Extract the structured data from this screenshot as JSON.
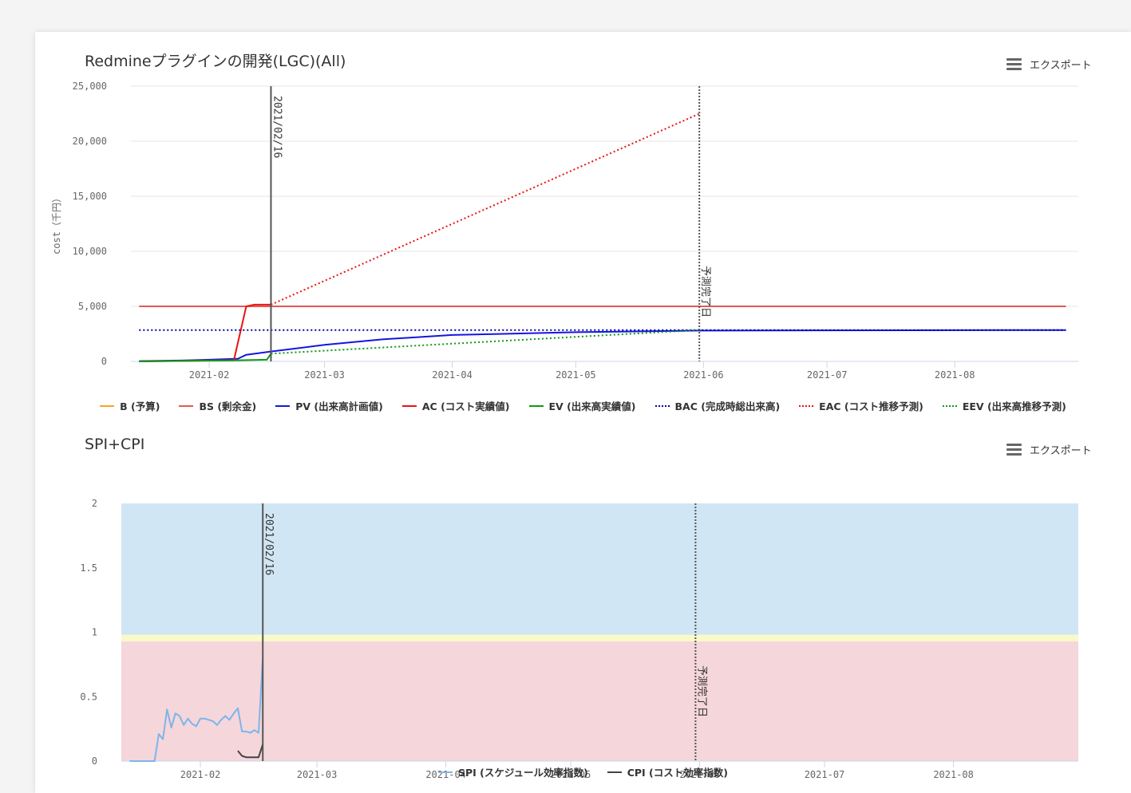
{
  "export_label": "エクスポート",
  "chart_data": [
    {
      "type": "line",
      "title": "Redmineプラグインの開発(LGC)(All)",
      "ylabel": "cost（千円）",
      "xlabel": "",
      "x_range": [
        "2021-01-13",
        "2021-08-31"
      ],
      "ylim": [
        0,
        25000
      ],
      "y_ticks": [
        "0",
        "5,000",
        "10,000",
        "15,000",
        "20,000",
        "25,000"
      ],
      "y_tick_values": [
        0,
        5000,
        10000,
        15000,
        20000,
        25000
      ],
      "x_ticks": [
        "2021-02",
        "2021-03",
        "2021-04",
        "2021-05",
        "2021-06",
        "2021-07",
        "2021-08"
      ],
      "x_tick_dates": [
        "2021-02-01",
        "2021-03-01",
        "2021-04-01",
        "2021-05-01",
        "2021-06-01",
        "2021-07-01",
        "2021-08-01"
      ],
      "grid": true,
      "legend_position": "bottom",
      "plot_lines": [
        {
          "date": "2021-02-16",
          "label": "2021/02/16",
          "style": "solid",
          "color": "#555555"
        },
        {
          "date": "2021-05-31",
          "label": "予測完了日",
          "style": "dotted",
          "color": "#555555"
        }
      ],
      "series": [
        {
          "name": "B (予算)",
          "color": "#f5a623",
          "dash": "solid",
          "points": []
        },
        {
          "name": "BS (剰余金)",
          "color": "#e05a52",
          "dash": "solid",
          "points": [
            [
              "2021-01-15",
              5000
            ],
            [
              "2021-08-28",
              5000
            ]
          ]
        },
        {
          "name": "PV (出来高計画値)",
          "color": "#1515e0",
          "dash": "solid",
          "points": [
            [
              "2021-01-15",
              30
            ],
            [
              "2021-01-25",
              80
            ],
            [
              "2021-02-01",
              150
            ],
            [
              "2021-02-08",
              250
            ],
            [
              "2021-02-10",
              600
            ],
            [
              "2021-02-16",
              900
            ],
            [
              "2021-03-01",
              1500
            ],
            [
              "2021-03-15",
              2000
            ],
            [
              "2021-04-01",
              2400
            ],
            [
              "2021-05-01",
              2650
            ],
            [
              "2021-05-31",
              2800
            ],
            [
              "2021-08-28",
              2850
            ]
          ]
        },
        {
          "name": "AC (コスト実績値)",
          "color": "#ee1111",
          "dash": "solid",
          "points": [
            [
              "2021-01-15",
              0
            ],
            [
              "2021-02-07",
              100
            ],
            [
              "2021-02-10",
              5000
            ],
            [
              "2021-02-12",
              5150
            ],
            [
              "2021-02-16",
              5150
            ]
          ]
        },
        {
          "name": "EV (出来高実績値)",
          "color": "#119911",
          "dash": "solid",
          "points": [
            [
              "2021-01-15",
              0
            ],
            [
              "2021-02-08",
              100
            ],
            [
              "2021-02-15",
              150
            ],
            [
              "2021-02-16",
              700
            ]
          ]
        },
        {
          "name": "BAC (完成時総出来高)",
          "color": "#0000aa",
          "dash": "dotted",
          "points": [
            [
              "2021-01-15",
              2850
            ],
            [
              "2021-08-28",
              2850
            ]
          ]
        },
        {
          "name": "EAC (コスト推移予測)",
          "color": "#ee1111",
          "dash": "dotted",
          "points": [
            [
              "2021-02-16",
              5150
            ],
            [
              "2021-05-31",
              22500
            ]
          ]
        },
        {
          "name": "EEV (出来高推移予測)",
          "color": "#119911",
          "dash": "dotted",
          "points": [
            [
              "2021-02-16",
              700
            ],
            [
              "2021-05-31",
              2850
            ]
          ]
        }
      ]
    },
    {
      "type": "line",
      "title": "SPI+CPI",
      "xlabel": "",
      "ylabel": "",
      "x_range": [
        "2021-01-13",
        "2021-08-31"
      ],
      "ylim": [
        0,
        2
      ],
      "y_ticks": [
        "0",
        "0.5",
        "1",
        "1.5",
        "2"
      ],
      "y_tick_values": [
        0,
        0.5,
        1,
        1.5,
        2
      ],
      "x_ticks": [
        "2021-02",
        "2021-03",
        "2021-04",
        "2021-05",
        "2021-06",
        "2021-07",
        "2021-08"
      ],
      "x_tick_dates": [
        "2021-02-01",
        "2021-03-01",
        "2021-04-01",
        "2021-05-01",
        "2021-06-01",
        "2021-07-01",
        "2021-08-01"
      ],
      "grid": false,
      "legend_position": "bottom",
      "bands": [
        {
          "from": 0,
          "to": 0.93,
          "color": "#f5d6da"
        },
        {
          "from": 0.93,
          "to": 0.98,
          "color": "#fafac8"
        },
        {
          "from": 0.98,
          "to": 2,
          "color": "#d1e6f4"
        }
      ],
      "plot_lines": [
        {
          "date": "2021-02-16",
          "label": "2021/02/16",
          "style": "solid",
          "color": "#555555"
        },
        {
          "date": "2021-05-31",
          "label": "予測完了日",
          "style": "dotted",
          "color": "#555555"
        }
      ],
      "series": [
        {
          "name": "SPI (スケジュール効率指数)",
          "color": "#7cb5ec",
          "dash": "solid",
          "points": [
            [
              "2021-01-15",
              0
            ],
            [
              "2021-01-18",
              0
            ],
            [
              "2021-01-21",
              0
            ],
            [
              "2021-01-22",
              0.21
            ],
            [
              "2021-01-23",
              0.17
            ],
            [
              "2021-01-24",
              0.4
            ],
            [
              "2021-01-25",
              0.26
            ],
            [
              "2021-01-26",
              0.37
            ],
            [
              "2021-01-27",
              0.35
            ],
            [
              "2021-01-28",
              0.28
            ],
            [
              "2021-01-29",
              0.33
            ],
            [
              "2021-01-30",
              0.29
            ],
            [
              "2021-01-31",
              0.27
            ],
            [
              "2021-02-01",
              0.33
            ],
            [
              "2021-02-02",
              0.33
            ],
            [
              "2021-02-04",
              0.31
            ],
            [
              "2021-02-05",
              0.28
            ],
            [
              "2021-02-06",
              0.32
            ],
            [
              "2021-02-07",
              0.35
            ],
            [
              "2021-02-08",
              0.32
            ],
            [
              "2021-02-09",
              0.37
            ],
            [
              "2021-02-10",
              0.41
            ],
            [
              "2021-02-11",
              0.23
            ],
            [
              "2021-02-12",
              0.23
            ],
            [
              "2021-02-13",
              0.22
            ],
            [
              "2021-02-14",
              0.24
            ],
            [
              "2021-02-15",
              0.22
            ],
            [
              "2021-02-16",
              0.8
            ]
          ]
        },
        {
          "name": "CPI (コスト効率指数)",
          "color": "#434348",
          "dash": "solid",
          "points": [
            [
              "2021-02-10",
              0.08
            ],
            [
              "2021-02-11",
              0.04
            ],
            [
              "2021-02-12",
              0.03
            ],
            [
              "2021-02-15",
              0.03
            ],
            [
              "2021-02-16",
              0.13
            ]
          ]
        }
      ]
    }
  ]
}
